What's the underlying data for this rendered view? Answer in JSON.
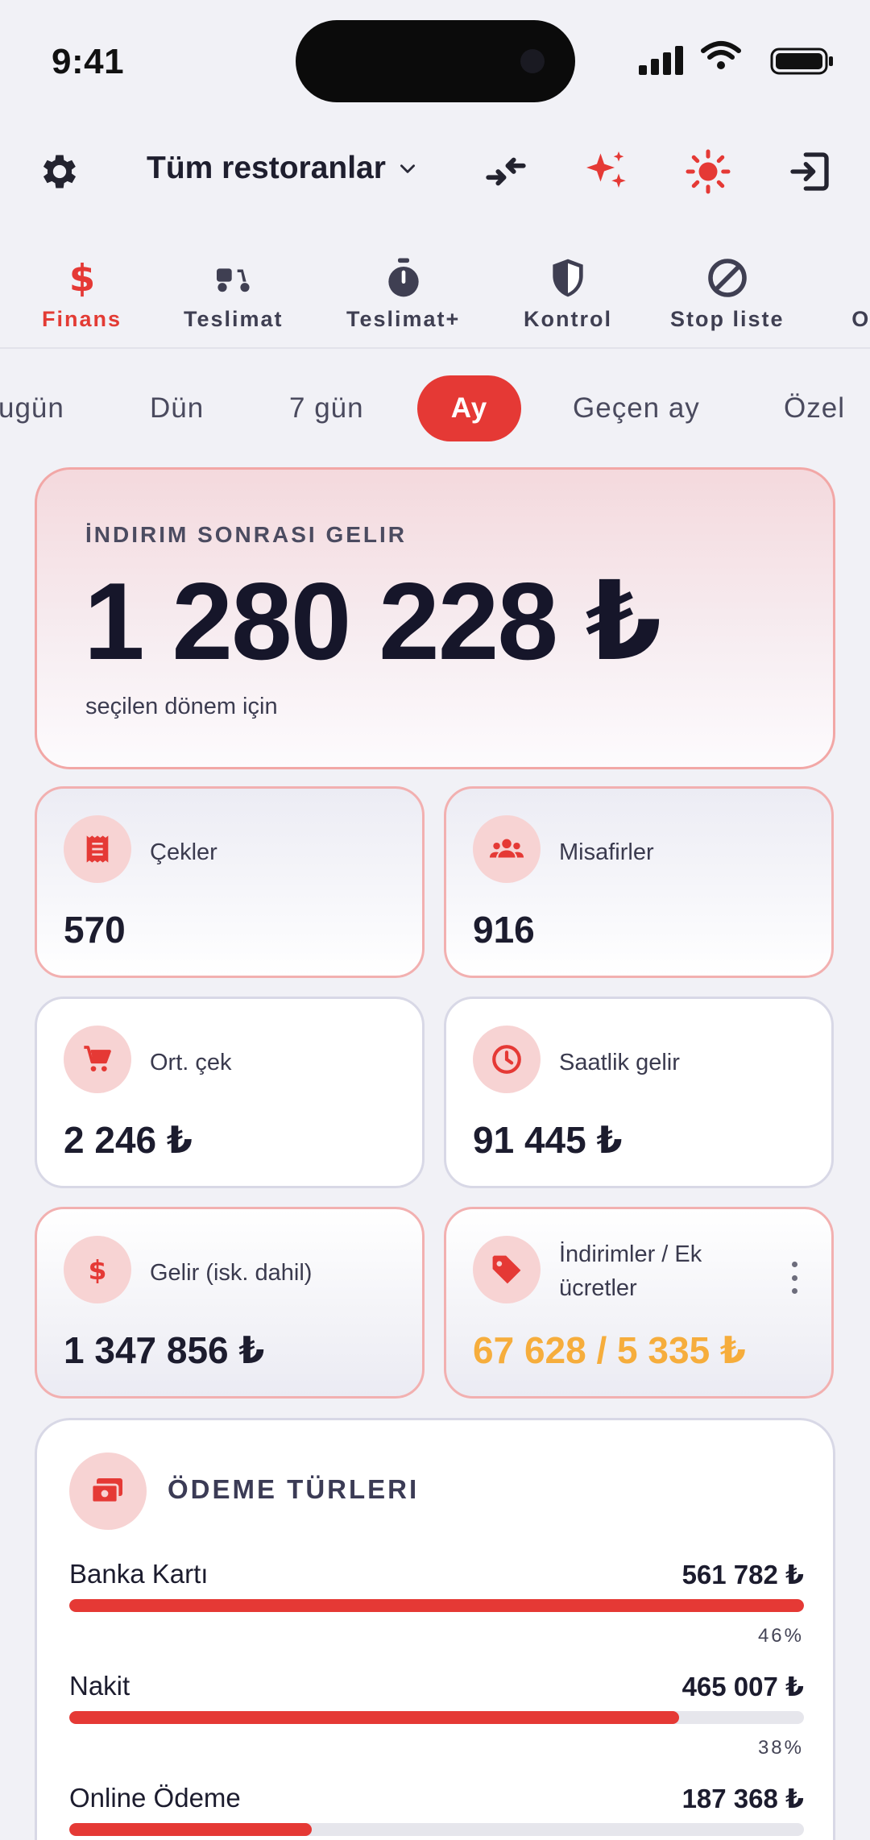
{
  "status_bar": {
    "time": "9:41"
  },
  "header": {
    "restaurant_selector": "Tüm restoranlar"
  },
  "tabs": [
    {
      "label": "Finans",
      "icon": "dollar-icon",
      "active": true
    },
    {
      "label": "Teslimat",
      "icon": "scooter-icon"
    },
    {
      "label": "Teslimat+",
      "icon": "stopwatch-icon"
    },
    {
      "label": "Kontrol",
      "icon": "shield-icon"
    },
    {
      "label": "Stop liste",
      "icon": "block-icon"
    },
    {
      "label": "Op"
    }
  ],
  "periods": [
    {
      "label": "ugün"
    },
    {
      "label": "Dün"
    },
    {
      "label": "7 gün"
    },
    {
      "label": "Ay",
      "active": true
    },
    {
      "label": "Geçen ay"
    },
    {
      "label": "Özel"
    }
  ],
  "hero": {
    "label": "İNDIRIM SONRASI GELIR",
    "value": "1 280 228 ₺",
    "subtitle": "seçilen dönem için"
  },
  "metrics": {
    "checks": {
      "label": "Çekler",
      "value": "570"
    },
    "guests": {
      "label": "Misafirler",
      "value": "916"
    },
    "avg_check": {
      "label": "Ort. çek",
      "value": "2 246 ₺"
    },
    "hourly": {
      "label": "Saatlik gelir",
      "value": "91 445 ₺"
    },
    "revenue": {
      "label": "Gelir (isk. dahil)",
      "value": "1 347 856 ₺"
    },
    "discounts": {
      "label": "İndirimler / Ek ücretler",
      "value": "67 628 / 5 335 ₺"
    }
  },
  "payments": {
    "title": "ÖDEME TÜRLERI",
    "rows": [
      {
        "name": "Banka Kartı",
        "amount": "561 782 ₺",
        "percent": "46%",
        "fill": 1.0
      },
      {
        "name": "Nakit",
        "amount": "465 007 ₺",
        "percent": "38%",
        "fill": 0.83
      },
      {
        "name": "Online Ödeme",
        "amount": "187 368 ₺",
        "percent": "",
        "fill": 0.33
      }
    ]
  },
  "colors": {
    "accent": "#e53935",
    "warning": "#f6ad3c",
    "text": "#1c1c2e"
  }
}
